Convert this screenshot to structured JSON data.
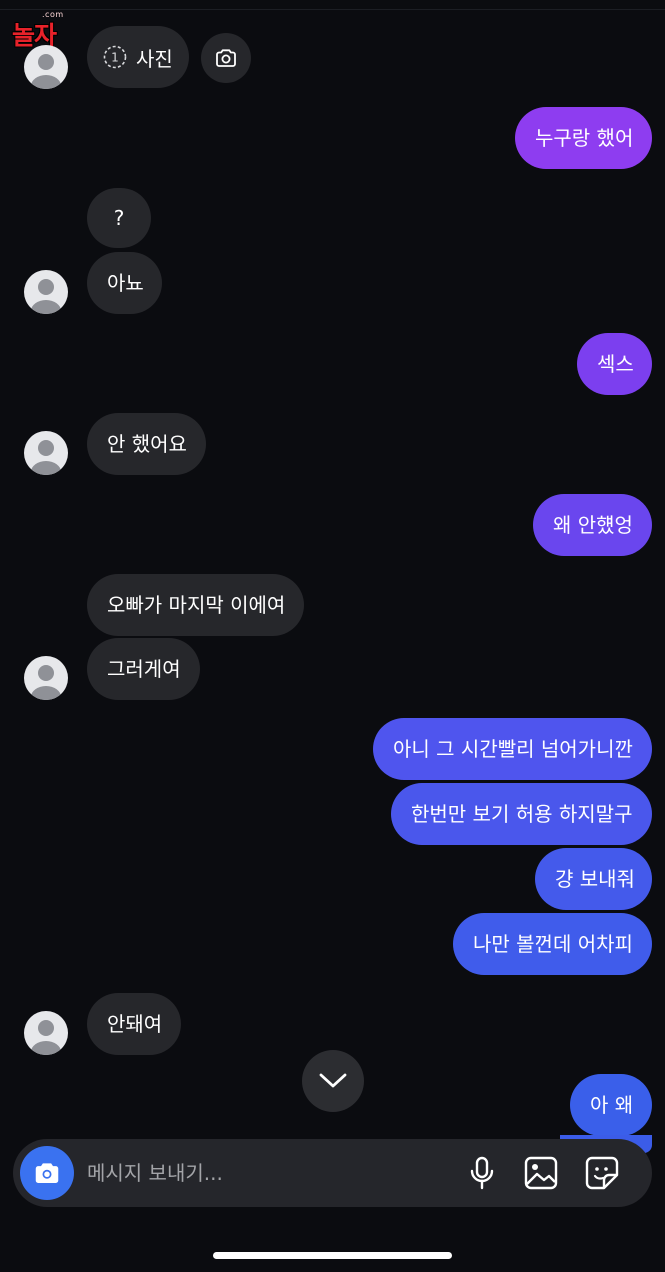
{
  "watermark": {
    "small": ".com",
    "text": "놀자"
  },
  "header": {
    "photo_chip": {
      "count": "1",
      "label": "사진"
    },
    "camera_chip_icon": "camera-icon"
  },
  "messages": [
    {
      "side": "out",
      "text": "누구랑 했어",
      "color": "#8e3df0"
    },
    {
      "side": "in",
      "text": "?"
    },
    {
      "side": "in",
      "text": "아뇨"
    },
    {
      "side": "out",
      "text": "섹스",
      "color": "#7c3fef"
    },
    {
      "side": "in",
      "text": "안 했어요"
    },
    {
      "side": "out",
      "text": "왜 안헀엉",
      "color": "#6a46ee"
    },
    {
      "side": "in",
      "text": "오빠가 마지막 이에여"
    },
    {
      "side": "in",
      "text": "그러게여"
    },
    {
      "side": "out",
      "text": "아니 그 시간빨리 넘어가니깐",
      "color": "#4f55ee"
    },
    {
      "side": "out",
      "text": "한번만 보기 허용 하지말구",
      "color": "#4a57ec"
    },
    {
      "side": "out",
      "text": "걍 보내줘",
      "color": "#445aeb"
    },
    {
      "side": "out",
      "text": "나만 볼껀데 어차피",
      "color": "#405ceb"
    },
    {
      "side": "in",
      "text": "안돼여"
    },
    {
      "side": "out",
      "text": "아 왜",
      "color": "#3a5fea"
    }
  ],
  "composer": {
    "placeholder": "메시지 보내기...",
    "icons": [
      "camera-icon",
      "microphone-icon",
      "gallery-icon",
      "sticker-icon"
    ],
    "accent": "#3a72f0"
  },
  "colors": {
    "background": "#0b0c10",
    "incoming_bubble": "#26272b",
    "outgoing_top": "#8e3df0",
    "outgoing_bottom": "#3a5fea"
  }
}
